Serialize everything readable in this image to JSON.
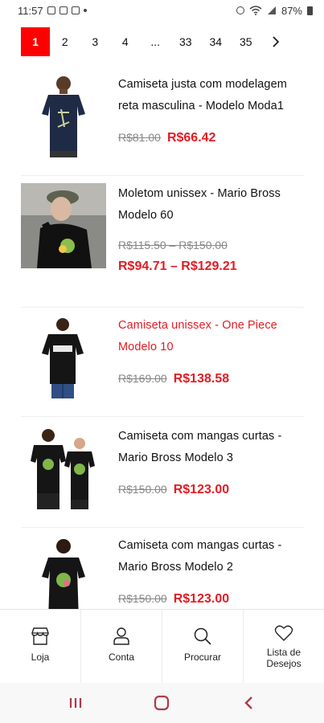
{
  "status_bar": {
    "time": "11:57",
    "battery": "87%"
  },
  "pagination": {
    "pages": [
      "1",
      "2",
      "3",
      "4",
      "...",
      "33",
      "34",
      "35"
    ],
    "active": "1"
  },
  "products": [
    {
      "title": "Camiseta justa com modelagem reta masculina - Modelo Moda1",
      "old_price": "R$81.00",
      "new_price": "R$66.42",
      "highlight": false
    },
    {
      "title": "Moletom unissex - Mario Bross Modelo 60",
      "old_price": "R$115.50 – R$150.00",
      "new_price": "R$94.71 – R$129.21",
      "highlight": false
    },
    {
      "title": "Camiseta unissex - One Piece Modelo 10",
      "old_price": "R$169.00",
      "new_price": "R$138.58",
      "highlight": true
    },
    {
      "title": "Camiseta com mangas curtas - Mario Bross Modelo 3",
      "old_price": "R$150.00",
      "new_price": "R$123.00",
      "highlight": false
    },
    {
      "title": "Camiseta com mangas curtas - Mario Bross Modelo 2",
      "old_price": "R$150.00",
      "new_price": "R$123.00",
      "highlight": false
    }
  ],
  "bottom_nav": {
    "store": "Loja",
    "account": "Conta",
    "search": "Procurar",
    "wishlist_line1": "Lista de",
    "wishlist_line2": "Desejos"
  },
  "colors": {
    "accent": "#e31b23",
    "active_page": "#ff0000"
  },
  "icons": [
    "store-icon",
    "user-icon",
    "search-icon",
    "heart-icon",
    "chevron-right-icon",
    "recent-apps-icon",
    "home-icon",
    "back-icon"
  ]
}
